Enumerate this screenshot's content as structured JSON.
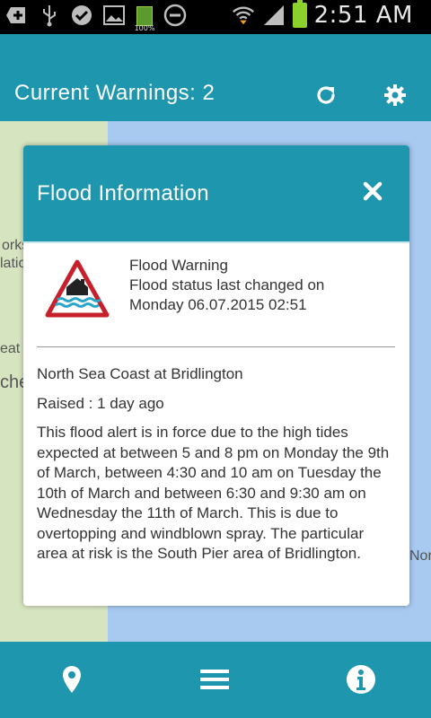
{
  "status_bar": {
    "time": "2:51 AM",
    "battery_small_label": "100%",
    "icons": [
      "add-icon",
      "usb-icon",
      "check-icon",
      "image-icon",
      "battery-small-icon",
      "block-icon",
      "wifi-icon",
      "signal-icon",
      "battery-icon"
    ]
  },
  "app_bar": {
    "title": "Current Warnings: 2",
    "refresh_icon": "refresh-icon",
    "settings_icon": "gear-icon"
  },
  "map": {
    "labels": [
      "orks",
      "latio",
      "eat",
      "che",
      "Nor"
    ]
  },
  "modal": {
    "title": "Flood Information",
    "close_icon": "close-icon",
    "warning_type": "Flood Warning",
    "status_line1": "Flood status last changed on",
    "status_line2": "Monday 06.07.2015 02:51",
    "location": "North Sea Coast at Bridlington",
    "raised": "Raised : 1 day ago",
    "description": "This flood alert is in force due to the high tides expected at between 5 and 8 pm on Monday the 9th of March, between 4:30 and 10 am on Tuesday the 10th of March and between 6:30 and 9:30 am on Wednesday the 11th of March. This is due to overtopping and windblown spray. The particular area at risk is the South Pier area of Bridlington."
  },
  "bottom_bar": {
    "items": [
      "location-pin-icon",
      "menu-icon",
      "info-icon"
    ]
  },
  "colors": {
    "primary": "#1e96ad",
    "warning_red": "#c8202a"
  }
}
